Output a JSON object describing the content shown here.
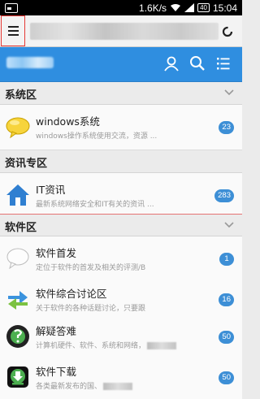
{
  "status_bar": {
    "speed": "1.6K/s",
    "battery": "40",
    "time": "15:04"
  },
  "header": {
    "icons": [
      "user-icon",
      "search-icon",
      "list-icon"
    ]
  },
  "colors": {
    "header_blue": "#2f8ee0",
    "badge_blue": "#3d8fd6",
    "highlight_red": "#e53935"
  },
  "sections": [
    {
      "title": "系统区",
      "forums": [
        {
          "name": "windows系统",
          "desc": "windows操作系统使用交流，资源 ...",
          "count": "23",
          "icon": "speech-bubble-yellow-icon"
        }
      ]
    },
    {
      "title": "资讯专区",
      "forums": [
        {
          "name": "IT资讯",
          "desc": "最新系统网络安全和IT有关的资讯 ...",
          "count": "283",
          "icon": "house-icon"
        }
      ]
    },
    {
      "title": "软件区",
      "forums": [
        {
          "name": "软件首发",
          "desc": "定位于软件的首发及相关的评测/B",
          "count": "1",
          "icon": "speech-bubble-white-icon"
        },
        {
          "name": "软件综合讨论区",
          "desc": "关于软件的各种话题讨论，只要跟",
          "count": "16",
          "icon": "exchange-arrows-icon"
        },
        {
          "name": "解疑答难",
          "desc": "计算机硬件、软件、系统和网络，",
          "count": "50",
          "icon": "help-globe-icon"
        },
        {
          "name": "软件下载",
          "desc": "各类最新发布的国、",
          "count": "50",
          "icon": "download-icon"
        }
      ]
    }
  ]
}
